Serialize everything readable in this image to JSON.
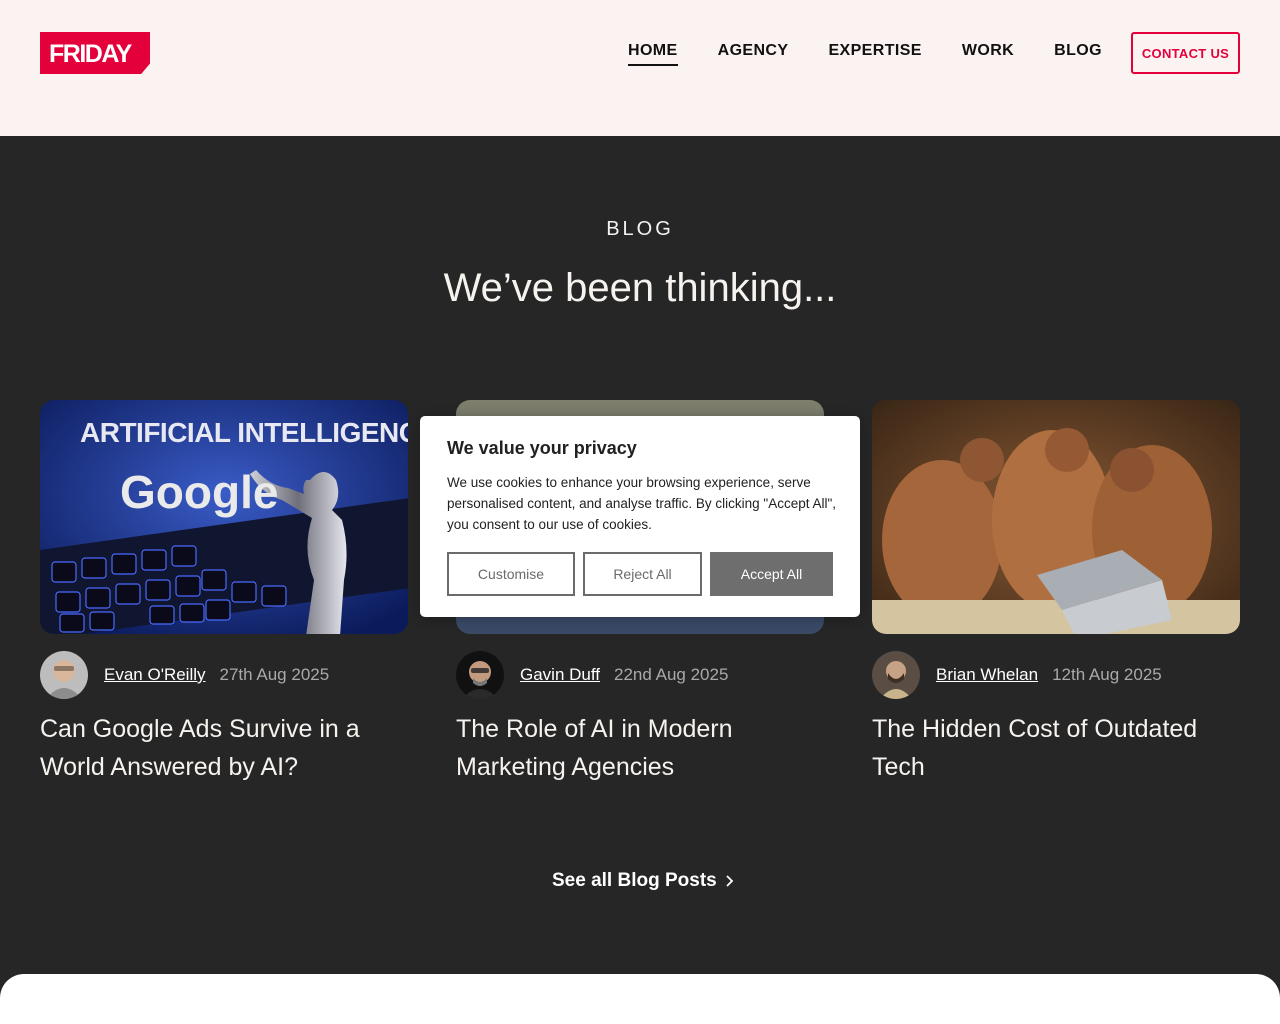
{
  "header": {
    "logo_text": "FRIDAY",
    "brand_color": "#e4003a",
    "nav": [
      {
        "label": "HOME",
        "active": true
      },
      {
        "label": "AGENCY",
        "active": false
      },
      {
        "label": "EXPERTISE",
        "active": false
      },
      {
        "label": "WORK",
        "active": false
      },
      {
        "label": "BLOG",
        "active": false
      }
    ],
    "contact_label": "CONTACT US"
  },
  "blog": {
    "label": "BLOG",
    "title": "We’ve been thinking...",
    "cards": [
      {
        "author": "Evan O'Reilly",
        "date": "27th Aug 2025",
        "title": "Can Google Ads Survive in a World Answered by AI?",
        "image_text_1": "ARTIFICIAL INTELLIGENCE",
        "image_text_2": "Google"
      },
      {
        "author": "Gavin Duff",
        "date": "22nd Aug 2025",
        "title": "The Role of AI in Modern Marketing Agencies"
      },
      {
        "author": "Brian Whelan",
        "date": "12th Aug 2025",
        "title": "The Hidden Cost of Outdated Tech"
      }
    ],
    "see_all": "See all Blog Posts"
  },
  "cookie": {
    "title": "We value your privacy",
    "body": "We use cookies to enhance your browsing experience, serve personalised content, and analyse traffic. By clicking \"Accept All\", you consent to our use of cookies.",
    "customise": "Customise",
    "reject": "Reject All",
    "accept": "Accept All"
  }
}
